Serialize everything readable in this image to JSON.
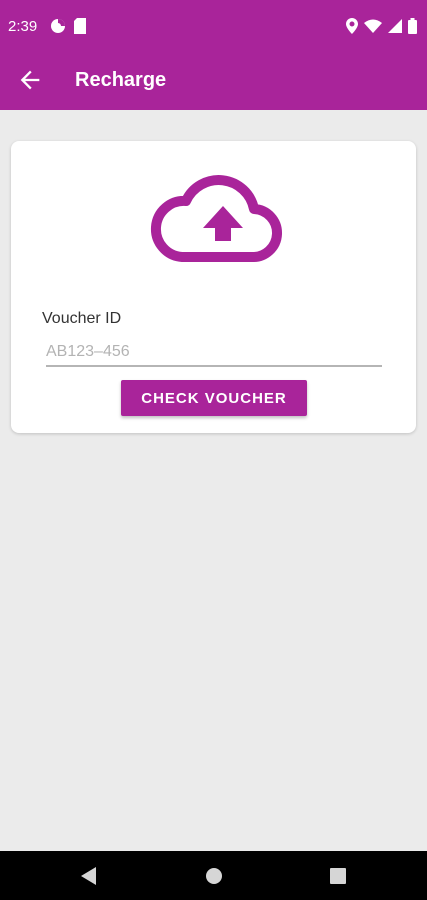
{
  "status_bar": {
    "time": "2:39",
    "icons": [
      "data-saver-icon",
      "sim-card-icon",
      "location-icon",
      "wifi-icon",
      "signal-icon",
      "battery-icon"
    ]
  },
  "app_bar": {
    "title": "Recharge",
    "back_icon": "arrow-back-icon"
  },
  "card": {
    "icon": "cloud-upload-icon",
    "voucher_label": "Voucher ID",
    "voucher_placeholder": "AB123–456",
    "voucher_value": "",
    "button_label": "CHECK VOUCHER"
  },
  "nav_bar": {
    "icons": [
      "back-triangle-icon",
      "home-circle-icon",
      "recents-square-icon"
    ]
  },
  "colors": {
    "accent": "#a9249a",
    "background": "#ebebeb",
    "card": "#ffffff",
    "nav_bar": "#000000"
  }
}
